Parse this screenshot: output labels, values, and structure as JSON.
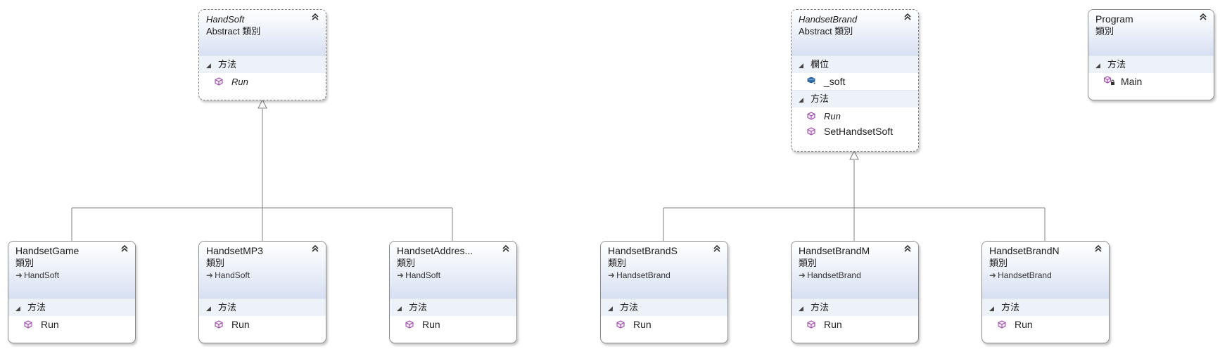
{
  "classes": {
    "handsoft": {
      "name": "HandSoft",
      "kind": "Abstract 類別",
      "sections": [
        {
          "title": "方法",
          "members": [
            "Run"
          ]
        }
      ]
    },
    "handsetbrand": {
      "name": "HandsetBrand",
      "kind": "Abstract 類別",
      "sections": [
        {
          "title": "欄位",
          "members": [
            "_soft"
          ]
        },
        {
          "title": "方法",
          "members": [
            "Run",
            "SetHandsetSoft"
          ]
        }
      ]
    },
    "program": {
      "name": "Program",
      "kind": "類別",
      "sections": [
        {
          "title": "方法",
          "members": [
            "Main"
          ]
        }
      ]
    },
    "handsetgame": {
      "name": "HandsetGame",
      "kind": "類別",
      "base": "HandSoft",
      "sections": [
        {
          "title": "方法",
          "members": [
            "Run"
          ]
        }
      ]
    },
    "handsetmp3": {
      "name": "HandsetMP3",
      "kind": "類別",
      "base": "HandSoft",
      "sections": [
        {
          "title": "方法",
          "members": [
            "Run"
          ]
        }
      ]
    },
    "handsetaddress": {
      "name": "HandsetAddres...",
      "kind": "類別",
      "base": "HandSoft",
      "sections": [
        {
          "title": "方法",
          "members": [
            "Run"
          ]
        }
      ]
    },
    "handsetbrands": {
      "name": "HandsetBrandS",
      "kind": "類別",
      "base": "HandsetBrand",
      "sections": [
        {
          "title": "方法",
          "members": [
            "Run"
          ]
        }
      ]
    },
    "handsetbrandm": {
      "name": "HandsetBrandM",
      "kind": "類別",
      "base": "HandsetBrand",
      "sections": [
        {
          "title": "方法",
          "members": [
            "Run"
          ]
        }
      ]
    },
    "handsetbrandn": {
      "name": "HandsetBrandN",
      "kind": "類別",
      "base": "HandsetBrand",
      "sections": [
        {
          "title": "方法",
          "members": [
            "Run"
          ]
        }
      ]
    }
  },
  "icons": {
    "method": "method-cube-icon",
    "field": "field-icon",
    "private_method": "private-method-icon",
    "collapse": "collapse-chevron-icon",
    "base_arrow": "inherit-arrow-icon"
  },
  "colors": {
    "header_gradient_end": "#d7e0f2",
    "section_bg": "#edf1f8",
    "method_icon": "#9b4fa8",
    "field_icon": "#2f6fa8",
    "line": "#7f7f7f"
  }
}
